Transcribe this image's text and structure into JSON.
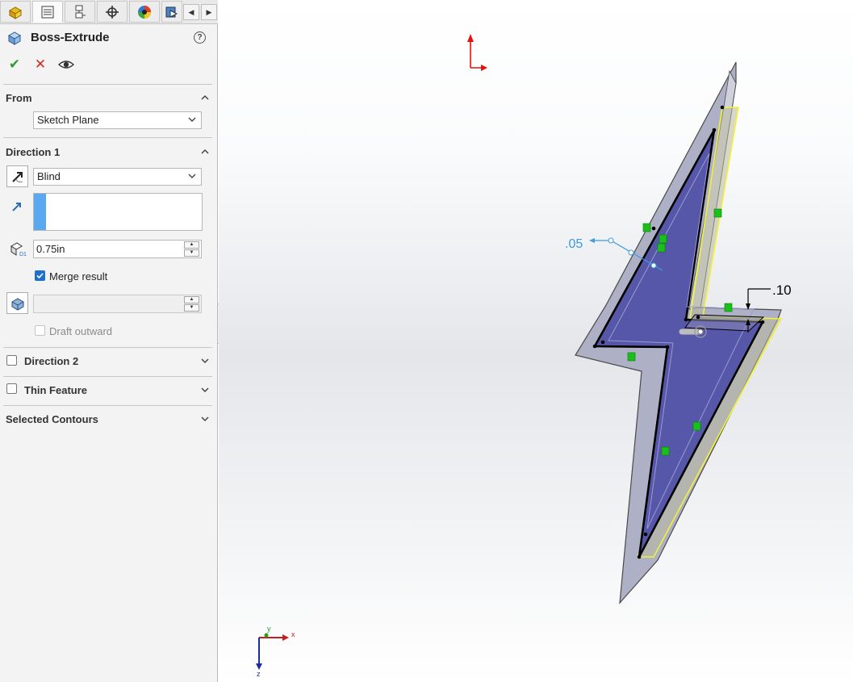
{
  "panel": {
    "tabs": [
      "feature-manager-icon",
      "property-manager-icon",
      "configuration-manager-icon",
      "dimxpert-icon",
      "display-manager-icon",
      "cam-tree-icon"
    ],
    "title": "Boss-Extrude",
    "help": "?",
    "actions": {
      "ok": "✔",
      "cancel": "✕",
      "preview": "eye-icon"
    }
  },
  "from": {
    "header": "From",
    "condition": "Sketch Plane"
  },
  "direction1": {
    "header": "Direction 1",
    "end_condition": "Blind",
    "depth": "0.75in",
    "merge_result_label": "Merge result",
    "merge_result_checked": true,
    "draft_outward_label": "Draft outward"
  },
  "direction2": {
    "header": "Direction 2"
  },
  "thin_feature": {
    "header": "Thin Feature"
  },
  "selected_contours": {
    "header": "Selected Contours"
  },
  "viewport": {
    "dim_offset": ".05",
    "dim_thickness": ".10",
    "triad": {
      "x": "x",
      "y": "y",
      "z": "z"
    },
    "colors": {
      "face": "#5657a8",
      "edge": "#000000",
      "preview": "#f2f23a",
      "relation": "#18c018",
      "dim": "#3d9ae0"
    }
  }
}
